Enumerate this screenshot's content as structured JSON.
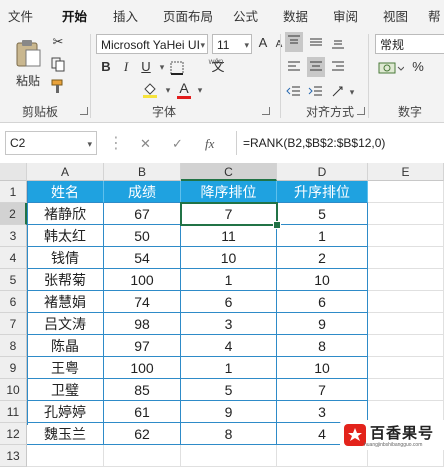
{
  "ribbon_tabs": [
    "文件",
    "开始",
    "插入",
    "页面布局",
    "公式",
    "数据",
    "审阅",
    "视图",
    "帮"
  ],
  "active_tab": "开始",
  "groups": {
    "clipboard": {
      "label": "剪贴板",
      "paste": "粘贴"
    },
    "font": {
      "label": "字体",
      "name": "Microsoft YaHei UI",
      "size": "11",
      "bold": "B",
      "italic": "I",
      "underline": "U",
      "grow": "A",
      "shrink": "A",
      "font_color": "A",
      "wen": "wén",
      "zh": "文"
    },
    "alignment": {
      "label": "对齐方式"
    },
    "number": {
      "label": "数字",
      "format": "常规",
      "percent": "%"
    }
  },
  "name_box": "C2",
  "fx": "fx",
  "formula": "=RANK(B2,$B$2:$B$12,0)",
  "columns": [
    "A",
    "B",
    "C",
    "D",
    "E"
  ],
  "row_numbers": [
    "1",
    "2",
    "3",
    "4",
    "5",
    "6",
    "7",
    "8",
    "9",
    "10",
    "11",
    "12",
    "13"
  ],
  "header": [
    "姓名",
    "成绩",
    "降序排位",
    "升序排位"
  ],
  "rows": [
    [
      "褚静欣",
      "67",
      "7",
      "5"
    ],
    [
      "韩太红",
      "50",
      "11",
      "1"
    ],
    [
      "钱倩",
      "54",
      "10",
      "2"
    ],
    [
      "张帮菊",
      "100",
      "1",
      "10"
    ],
    [
      "褚慧娟",
      "74",
      "6",
      "6"
    ],
    [
      "吕文涛",
      "98",
      "3",
      "9"
    ],
    [
      "陈晶",
      "97",
      "4",
      "8"
    ],
    [
      "王粤",
      "100",
      "1",
      "10"
    ],
    [
      "卫璧",
      "85",
      "5",
      "7"
    ],
    [
      "孔婷婷",
      "61",
      "9",
      "3"
    ],
    [
      "魏玉兰",
      "62",
      "8",
      "4"
    ]
  ],
  "watermark": {
    "brand": "百香果号",
    "url": "huangjinbshibangguo.com"
  },
  "colors": {
    "accent": "#217346",
    "header_fill": "#1fa2e0",
    "table_border": "#2e8bc8"
  }
}
